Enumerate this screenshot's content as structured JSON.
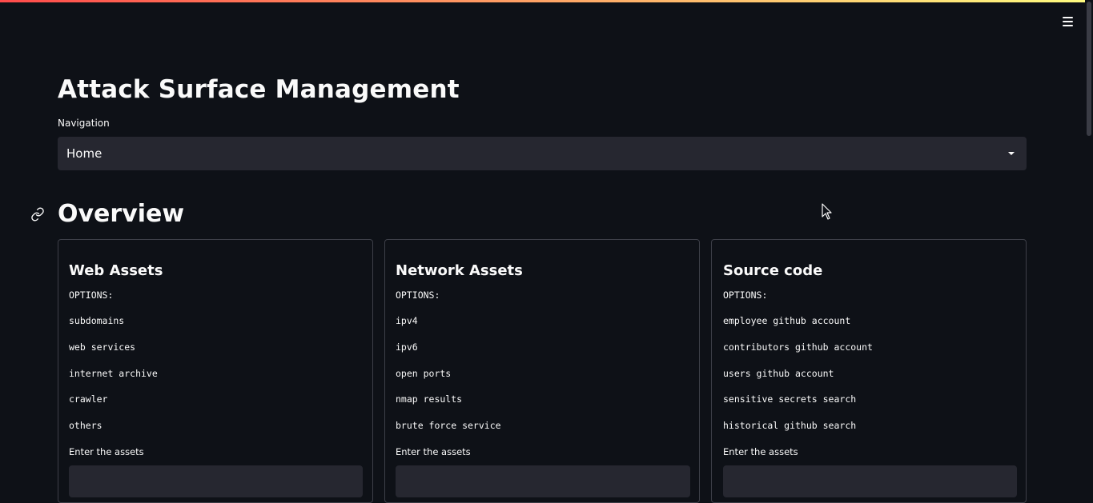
{
  "app": {
    "title": "Attack Surface Management",
    "menu_icon": "hamburger-menu-icon"
  },
  "navigation": {
    "label": "Navigation",
    "selected": "Home"
  },
  "overview": {
    "heading": "Overview",
    "cards": [
      {
        "title": "Web Assets",
        "options_label": "OPTIONS:",
        "options": [
          "subdomains",
          "web services",
          "internet archive",
          "crawler",
          "others"
        ],
        "input_label": "Enter the assets",
        "input_value": ""
      },
      {
        "title": "Network Assets",
        "options_label": "OPTIONS:",
        "options": [
          "ipv4",
          "ipv6",
          "open ports",
          "nmap results",
          "brute force service"
        ],
        "input_label": "Enter the assets",
        "input_value": ""
      },
      {
        "title": "Source code",
        "options_label": "OPTIONS:",
        "options": [
          "employee github account",
          "contributors github account",
          "users github account",
          "sensitive secrets search",
          "historical github search"
        ],
        "input_label": "Enter the assets",
        "input_value": ""
      }
    ]
  },
  "colors": {
    "background": "#0e1117",
    "widget": "#262730",
    "text": "#fafafa",
    "border": "#3d3f48",
    "accent_gradient_start": "#ff4b4b",
    "accent_gradient_end": "#fffd80"
  }
}
